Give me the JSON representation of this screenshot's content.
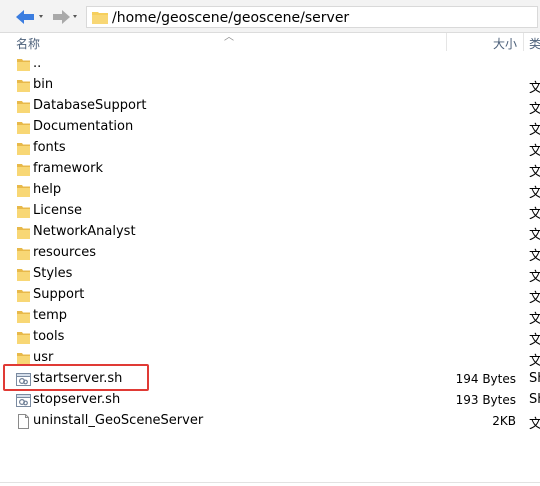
{
  "address": {
    "path": "/home/geoscene/geoscene/server"
  },
  "columns": {
    "name": "名称",
    "size": "大小",
    "type": "类"
  },
  "rows": [
    {
      "kind": "folder",
      "name": "..",
      "size": "",
      "type": ""
    },
    {
      "kind": "folder",
      "name": "bin",
      "size": "",
      "type": "文"
    },
    {
      "kind": "folder",
      "name": "DatabaseSupport",
      "size": "",
      "type": "文"
    },
    {
      "kind": "folder",
      "name": "Documentation",
      "size": "",
      "type": "文"
    },
    {
      "kind": "folder",
      "name": "fonts",
      "size": "",
      "type": "文"
    },
    {
      "kind": "folder",
      "name": "framework",
      "size": "",
      "type": "文"
    },
    {
      "kind": "folder",
      "name": "help",
      "size": "",
      "type": "文"
    },
    {
      "kind": "folder",
      "name": "License",
      "size": "",
      "type": "文"
    },
    {
      "kind": "folder",
      "name": "NetworkAnalyst",
      "size": "",
      "type": "文"
    },
    {
      "kind": "folder",
      "name": "resources",
      "size": "",
      "type": "文"
    },
    {
      "kind": "folder",
      "name": "Styles",
      "size": "",
      "type": "文"
    },
    {
      "kind": "folder",
      "name": "Support",
      "size": "",
      "type": "文"
    },
    {
      "kind": "folder",
      "name": "temp",
      "size": "",
      "type": "文"
    },
    {
      "kind": "folder",
      "name": "tools",
      "size": "",
      "type": "文"
    },
    {
      "kind": "folder",
      "name": "usr",
      "size": "",
      "type": "文"
    },
    {
      "kind": "script",
      "name": "startserver.sh",
      "size": "194 Bytes",
      "type": "Sh"
    },
    {
      "kind": "script",
      "name": "stopserver.sh",
      "size": "193 Bytes",
      "type": "Sh"
    },
    {
      "kind": "file",
      "name": "uninstall_GeoSceneServer",
      "size": "2KB",
      "type": "文"
    }
  ],
  "icons": {
    "back": "arrow-left-icon",
    "forward": "arrow-right-icon",
    "folder": "folder-icon",
    "script": "shell-script-icon",
    "file": "blank-file-icon"
  },
  "colors": {
    "highlight": "#e03a35",
    "folder": "#f6cf5d",
    "back_arrow": "#3b7de0"
  }
}
